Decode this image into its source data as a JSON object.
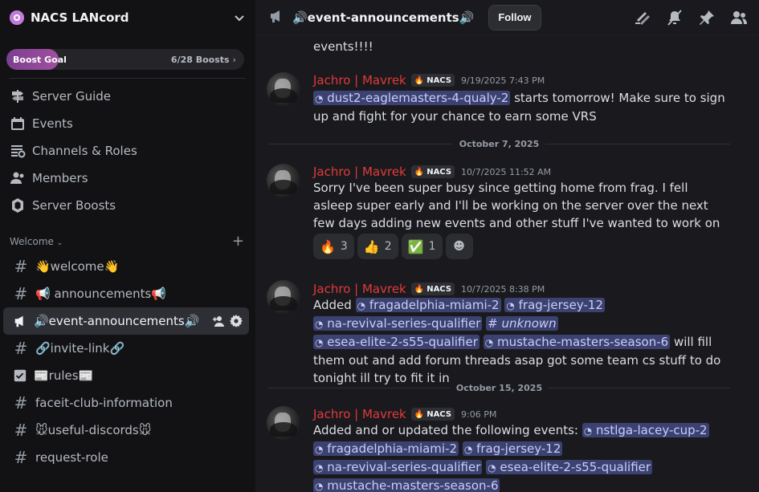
{
  "server": {
    "name": "NACS LANcord",
    "boost_label": "Boost Goal",
    "boost_count": "6/28 Boosts",
    "boost_progress": 0.214
  },
  "nav": [
    {
      "id": "server-guide",
      "label": "Server Guide",
      "icon": "signpost-icon"
    },
    {
      "id": "events",
      "label": "Events",
      "icon": "calendar-icon"
    },
    {
      "id": "channels-roles",
      "label": "Channels & Roles",
      "icon": "channels-roles-icon"
    },
    {
      "id": "members",
      "label": "Members",
      "icon": "members-icon"
    },
    {
      "id": "server-boosts",
      "label": "Server Boosts",
      "icon": "boost-icon"
    }
  ],
  "category": {
    "label": "Welcome"
  },
  "channels": [
    {
      "name": "👋welcome👋",
      "icon": "hash-icon"
    },
    {
      "name": "📢 announcements📢",
      "icon": "hash-icon"
    },
    {
      "name": "🔊event-announcements🔊",
      "icon": "megaphone-icon",
      "active": true
    },
    {
      "name": "🔗invite-link🔗",
      "icon": "hash-icon"
    },
    {
      "name": "📰rules📰",
      "icon": "checklist-icon"
    },
    {
      "name": "faceit-club-information",
      "icon": "hash-icon"
    },
    {
      "name": "🐭useful-discords🐭",
      "icon": "hash-icon"
    },
    {
      "name": "request-role",
      "icon": "hash-icon"
    }
  ],
  "header": {
    "channel_title": "🔊event-announcements🔊",
    "follow_label": "Follow"
  },
  "messages": {
    "top_fragment": "events!!!!",
    "m1": {
      "author": "Jachro | Mavrek",
      "tag": "NACS",
      "timestamp": "9/19/2025 7:43 PM",
      "mention1": "dust2-eaglemasters-4-qualy-2",
      "text1": " starts tomorrow! Make sure to sign up and fight for your chance to earn some VRS"
    },
    "div1": "October 7, 2025",
    "m2": {
      "author": "Jachro | Mavrek",
      "tag": "NACS",
      "timestamp": "10/7/2025 11:52 AM",
      "text": "Sorry I've been super busy since getting home from frag. I fell asleep super early and I'll be working on the server over the next few days adding new events and other stuff I've wanted to work on",
      "reactions": [
        {
          "emoji": "🔥",
          "count": "3"
        },
        {
          "emoji": "👍",
          "count": "2"
        },
        {
          "emoji": "✅",
          "count": "1"
        }
      ]
    },
    "m3": {
      "author": "Jachro | Mavrek",
      "tag": "NACS",
      "timestamp": "10/7/2025 8:38 PM",
      "prefix": "Added ",
      "mentions": [
        "fragadelphia-miami-2",
        "frag-jersey-12",
        "na-revival-series-qualifier",
        "unknown",
        "esea-elite-2-s55-qualifier",
        "mustache-masters-season-6"
      ],
      "suffix": " will fill them out and add forum threads asap got some team cs stuff to do tonight ill try to fit it in"
    },
    "div2": "October 15, 2025",
    "m4": {
      "author": "Jachro | Mavrek",
      "tag": "NACS",
      "timestamp": "9:06 PM",
      "prefix": "Added and or updated the following events: ",
      "mentions": [
        "nstlga-lacey-cup-2",
        "fragadelphia-miami-2",
        "frag-jersey-12",
        "na-revival-series-qualifier",
        "esea-elite-2-s55-qualifier",
        "mustache-masters-season-6"
      ]
    }
  }
}
